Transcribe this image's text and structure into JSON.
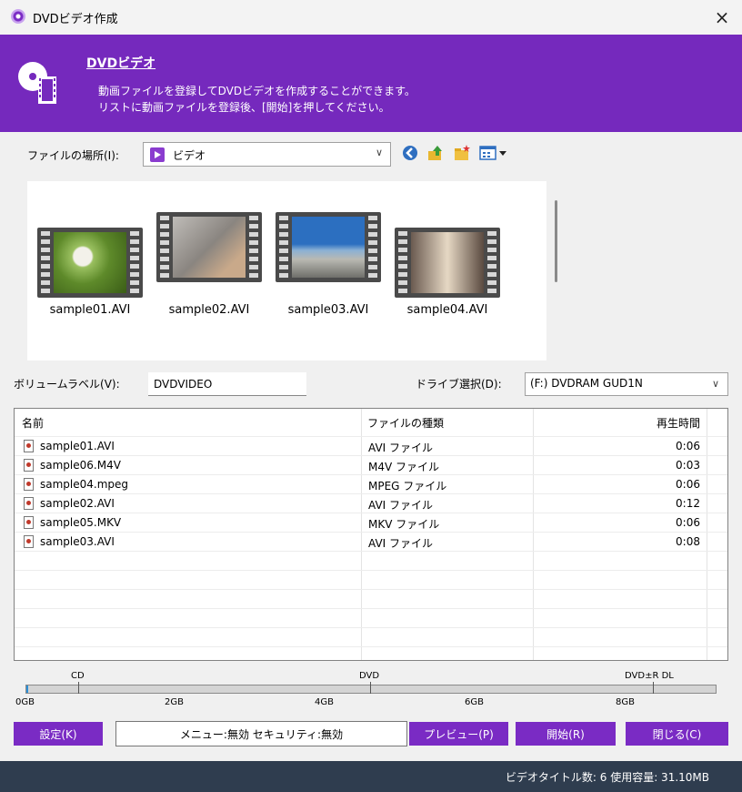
{
  "window": {
    "title": "DVDビデオ作成",
    "close_icon": "×"
  },
  "header": {
    "title": "DVDビデオ",
    "line1": "動画ファイルを登録してDVDビデオを作成することができます。",
    "line2": "リストに動画ファイルを登録後、[開始]を押してください。",
    "bg_color": "#7529bd"
  },
  "location": {
    "label": "ファイルの場所(I):",
    "value": "ビデオ",
    "icons": [
      "back-icon",
      "up-folder-icon",
      "new-folder-icon",
      "view-menu-icon"
    ]
  },
  "thumbnails": [
    {
      "label": "sample01.AVI"
    },
    {
      "label": "sample02.AVI"
    },
    {
      "label": "sample03.AVI"
    },
    {
      "label": "sample04.AVI"
    }
  ],
  "volume": {
    "label": "ボリュームラベル(V):",
    "value": "DVDVIDEO"
  },
  "drive": {
    "label": "ドライブ選択(D):",
    "value": "(F:) DVDRAM GUD1N"
  },
  "list": {
    "headers": {
      "name": "名前",
      "type": "ファイルの種類",
      "duration": "再生時間"
    },
    "rows": [
      {
        "name": "sample01.AVI",
        "type": "AVI ファイル",
        "duration": "0:06"
      },
      {
        "name": "sample06.M4V",
        "type": "M4V ファイル",
        "duration": "0:03"
      },
      {
        "name": "sample04.mpeg",
        "type": "MPEG ファイル",
        "duration": "0:06"
      },
      {
        "name": "sample02.AVI",
        "type": "AVI ファイル",
        "duration": "0:12"
      },
      {
        "name": "sample05.MKV",
        "type": "MKV ファイル",
        "duration": "0:06"
      },
      {
        "name": "sample03.AVI",
        "type": "AVI ファイル",
        "duration": "0:08"
      }
    ]
  },
  "capacity": {
    "markers": {
      "cd": "CD",
      "dvd": "DVD",
      "dvd_dl": "DVD±R DL"
    },
    "scale": [
      "0GB",
      "2GB",
      "4GB",
      "6GB",
      "8GB"
    ],
    "used_gb": 0.0311
  },
  "buttons": {
    "settings": "設定(K)",
    "preview": "プレビュー(P)",
    "start": "開始(R)",
    "close": "閉じる(C)"
  },
  "info": "メニュー:無効 セキュリティ:無効",
  "status": "ビデオタイトル数: 6  使用容量: 31.10MB",
  "colors": {
    "accent": "#7a2bc4",
    "status_bar": "#2f3d4f"
  }
}
